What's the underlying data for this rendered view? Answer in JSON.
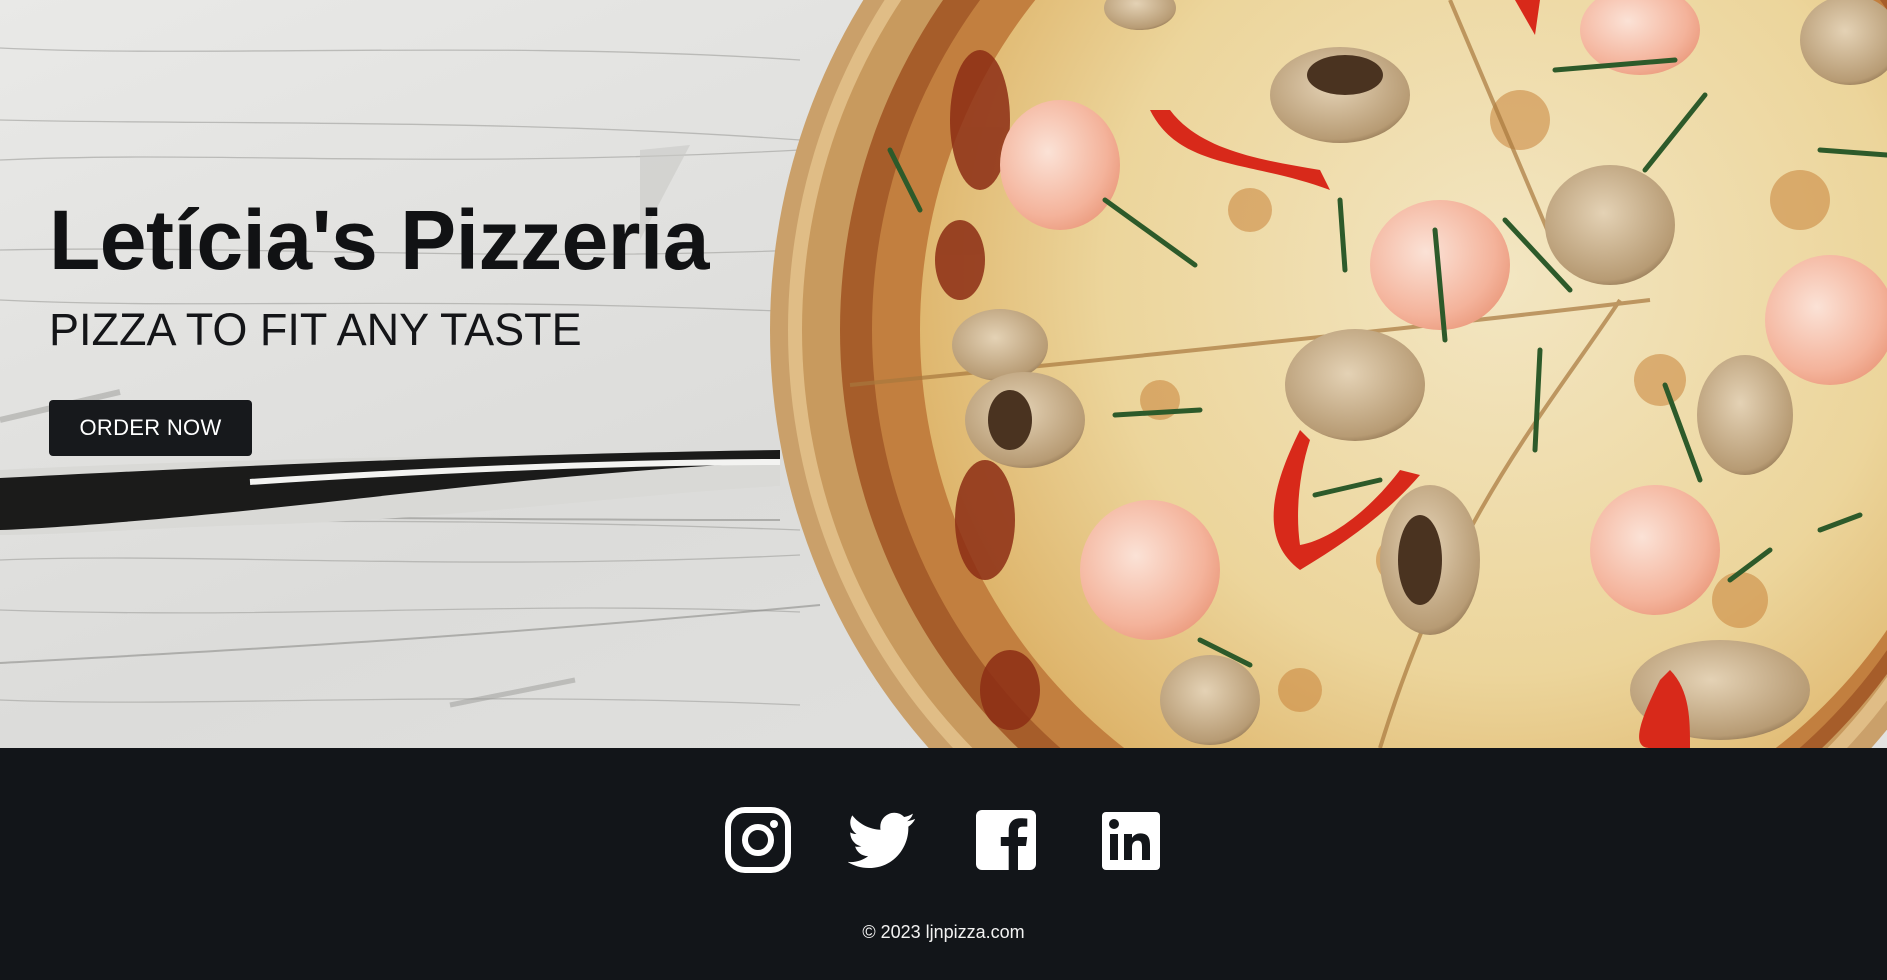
{
  "hero": {
    "title": "Letícia's Pizzeria",
    "subtitle": "PIZZA TO FIT ANY TASTE",
    "order_button_label": "ORDER NOW"
  },
  "footer": {
    "social": [
      {
        "name": "instagram-icon"
      },
      {
        "name": "twitter-icon"
      },
      {
        "name": "facebook-icon"
      },
      {
        "name": "linkedin-icon"
      }
    ],
    "copyright": "© 2023 ljnpizza.com"
  },
  "colors": {
    "footer_bg": "#121519",
    "button_bg": "#17191c",
    "text_dark": "#111214"
  }
}
